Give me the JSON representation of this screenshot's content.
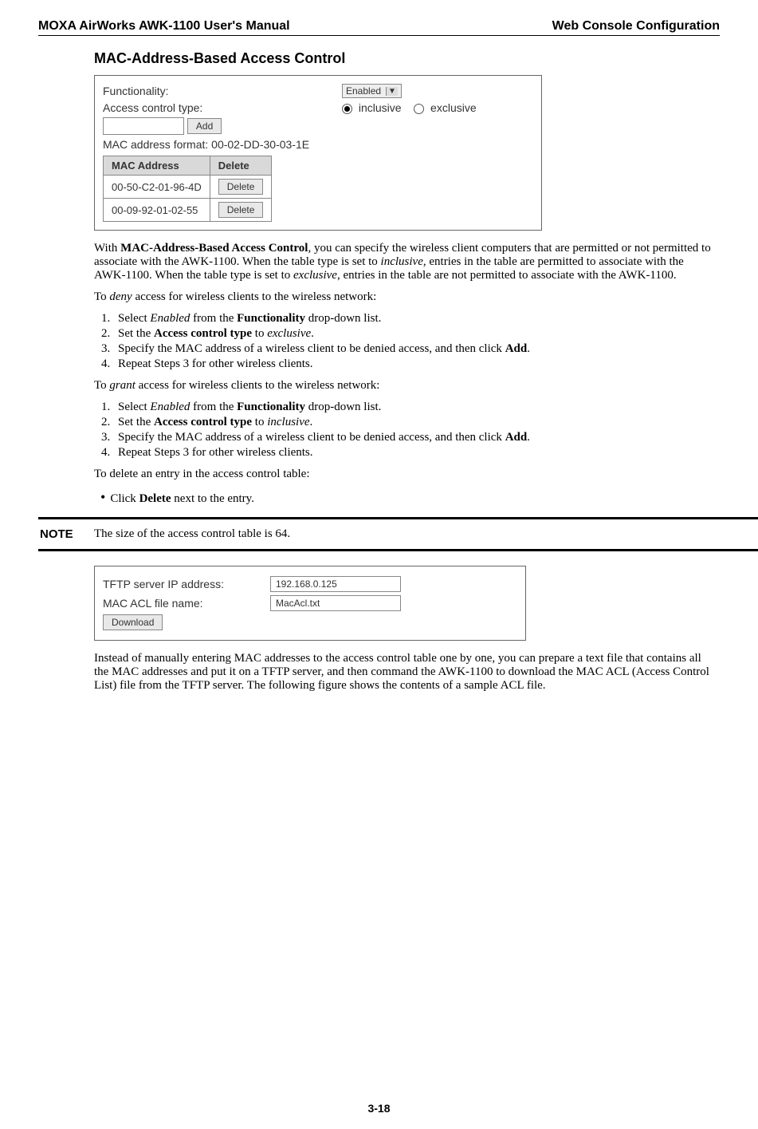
{
  "header": {
    "left": "MOXA AirWorks AWK-1100 User's Manual",
    "right": "Web Console Configuration"
  },
  "section_title": "MAC-Address-Based Access Control",
  "ui1": {
    "functionality_label": "Functionality:",
    "functionality_value": "Enabled",
    "acl_type_label": "Access control type:",
    "acl_inclusive": "inclusive",
    "acl_exclusive": "exclusive",
    "add_button": "Add",
    "mac_format": "MAC address format: 00-02-DD-30-03-1E",
    "table_h1": "MAC Address",
    "table_h2": "Delete",
    "rows": [
      {
        "mac": "00-50-C2-01-96-4D",
        "btn": "Delete"
      },
      {
        "mac": "00-09-92-01-02-55",
        "btn": "Delete"
      }
    ]
  },
  "para1_pre": "With ",
  "para1_bold": "MAC-Address-Based Access Control",
  "para1_post1": ", you can specify the wireless client computers that are permitted or not permitted to associate with the AWK-1100. When the table type is set to ",
  "para1_it1": "inclusive",
  "para1_post2": ", entries in the table are permitted to associate with the AWK-1100. When the table type is set to ",
  "para1_it2": "exclusive",
  "para1_post3": ", entries in the table are not permitted to associate with the AWK-1100.",
  "deny_intro_pre": "To ",
  "deny_intro_it": "deny",
  "deny_intro_post": " access for wireless clients to the wireless network:",
  "deny_steps": {
    "s1a": "Select ",
    "s1it": "Enabled",
    "s1b": " from the ",
    "s1bold": "Functionality",
    "s1c": " drop-down list.",
    "s2a": "Set the ",
    "s2bold": "Access control type",
    "s2b": " to ",
    "s2it": "exclusive",
    "s2c": ".",
    "s3a": "Specify the MAC address of a wireless client to be denied access, and then click ",
    "s3bold": "Add",
    "s3b": ".",
    "s4": "Repeat Steps 3 for other wireless clients."
  },
  "grant_intro_pre": "To ",
  "grant_intro_it": "grant",
  "grant_intro_post": " access for wireless clients to the wireless network:",
  "grant_steps": {
    "s1a": "Select ",
    "s1it": "Enabled",
    "s1b": " from the ",
    "s1bold": "Functionality",
    "s1c": " drop-down list.",
    "s2a": "Set the ",
    "s2bold": "Access control type",
    "s2b": " to ",
    "s2it": "inclusive",
    "s2c": ".",
    "s3a": "Specify the MAC address of a wireless client to be denied access, and then click ",
    "s3bold": "Add",
    "s3b": ".",
    "s4": "Repeat Steps 3 for other wireless clients."
  },
  "delete_intro": "To delete an entry in the access control table:",
  "delete_bullet_a": "Click ",
  "delete_bullet_bold": "Delete",
  "delete_bullet_b": " next to the entry.",
  "note_label": "NOTE",
  "note_text": "The size of the access control table is 64.",
  "ui2": {
    "tftp_label": "TFTP server IP address:",
    "tftp_value": "192.168.0.125",
    "acl_file_label": "MAC ACL file name:",
    "acl_file_value": "MacAcl.txt",
    "download": "Download"
  },
  "para_tftp": "Instead of manually entering MAC addresses to the access control table one by one, you can prepare a text file that contains all the MAC addresses and put it on a TFTP server, and then command the AWK-1100 to download the MAC ACL (Access Control List) file from the TFTP server. The following figure shows the contents of a sample ACL file.",
  "page_number": "3-18"
}
